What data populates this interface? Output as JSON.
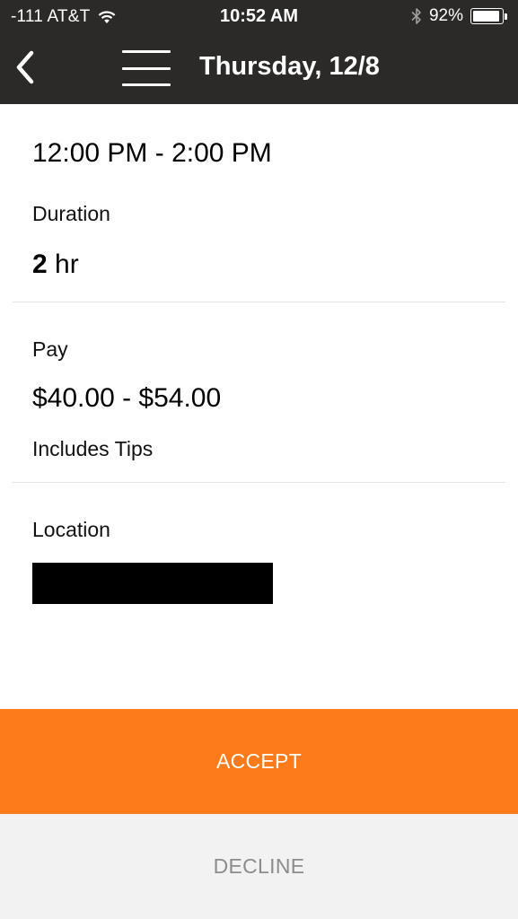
{
  "status_bar": {
    "carrier": "-111 AT&T",
    "time": "10:52 AM",
    "battery": "92%",
    "battery_level": 0.92
  },
  "header": {
    "title": "Thursday, 12/8",
    "back_icon": "chevron-left-icon",
    "menu_icon": "hamburger-menu-icon"
  },
  "shift": {
    "time_range": "12:00 PM - 2:00 PM",
    "duration_label": "Duration",
    "duration_number": "2",
    "duration_unit": "hr",
    "pay_label": "Pay",
    "pay_range": "$40.00 - $54.00",
    "pay_note": "Includes Tips",
    "location_label": "Location"
  },
  "actions": {
    "accept_label": "ACCEPT",
    "decline_label": "DECLINE"
  },
  "colors": {
    "header_bg": "#2c2a29",
    "accept_bg": "#fd7b1a",
    "decline_bg": "#f2f2f2",
    "decline_text": "#8c8c8c"
  }
}
